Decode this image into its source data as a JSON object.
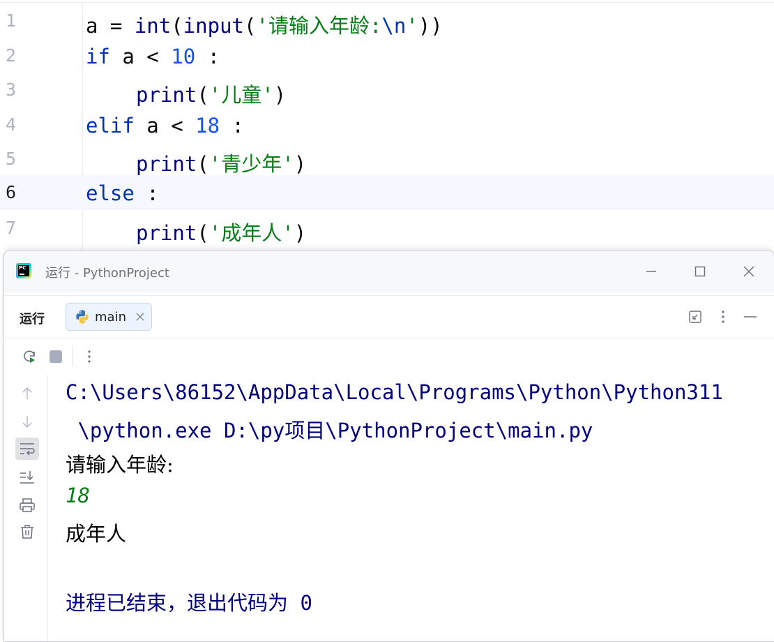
{
  "editor": {
    "lines": [
      {
        "num": "1",
        "segments": [
          {
            "text": "a = ",
            "cls": ""
          },
          {
            "text": "int",
            "cls": "tok-fn"
          },
          {
            "text": "(",
            "cls": ""
          },
          {
            "text": "input",
            "cls": "tok-fn"
          },
          {
            "text": "(",
            "cls": ""
          },
          {
            "text": "'请输入年龄:",
            "cls": "tok-str"
          },
          {
            "text": "\\n",
            "cls": "tok-kw"
          },
          {
            "text": "'",
            "cls": "tok-str"
          },
          {
            "text": "))",
            "cls": ""
          }
        ]
      },
      {
        "num": "2",
        "segments": [
          {
            "text": "if",
            "cls": "tok-kw"
          },
          {
            "text": " a < ",
            "cls": ""
          },
          {
            "text": "10",
            "cls": "tok-num"
          },
          {
            "text": " :",
            "cls": ""
          }
        ]
      },
      {
        "num": "3",
        "segments": [
          {
            "text": "print",
            "cls": "tok-fn"
          },
          {
            "text": "(",
            "cls": ""
          },
          {
            "text": "'儿童'",
            "cls": "tok-str"
          },
          {
            "text": ")",
            "cls": ""
          }
        ]
      },
      {
        "num": "4",
        "segments": [
          {
            "text": "elif",
            "cls": "tok-kw"
          },
          {
            "text": " a < ",
            "cls": ""
          },
          {
            "text": "18",
            "cls": "tok-num"
          },
          {
            "text": " :",
            "cls": ""
          }
        ]
      },
      {
        "num": "5",
        "segments": [
          {
            "text": "print",
            "cls": "tok-fn"
          },
          {
            "text": "(",
            "cls": ""
          },
          {
            "text": "'青少年'",
            "cls": "tok-str"
          },
          {
            "text": ")",
            "cls": ""
          }
        ]
      },
      {
        "num": "6",
        "segments": [
          {
            "text": "else",
            "cls": "tok-kw"
          },
          {
            "text": " :",
            "cls": ""
          }
        ]
      },
      {
        "num": "7",
        "segments": [
          {
            "text": "print",
            "cls": "tok-fn"
          },
          {
            "text": "(",
            "cls": ""
          },
          {
            "text": "'成年人'",
            "cls": "tok-str"
          },
          {
            "text": ")",
            "cls": ""
          }
        ]
      }
    ],
    "current_line": "6"
  },
  "run_window": {
    "title": "运行 - PythonProject",
    "run_label": "运行",
    "tab": {
      "label": "main",
      "icon": "python-icon"
    },
    "window_buttons": [
      "minimize-icon",
      "maximize-icon",
      "close-icon"
    ],
    "tab_bar_icons": [
      "restore-layout-icon",
      "more-vertical-icon",
      "hide-icon"
    ],
    "toolbar_icons": [
      "rerun-icon",
      "stop-icon",
      "more-vertical-icon"
    ],
    "side_icons": [
      "arrow-up-icon",
      "arrow-down-icon",
      "soft-wrap-icon",
      "scroll-to-end-icon",
      "print-icon",
      "trash-icon"
    ]
  },
  "console": {
    "command_line_1": "C:\\Users\\86152\\AppData\\Local\\Programs\\Python\\Python311",
    "command_line_2": " \\python.exe D:\\py项目\\PythonProject\\main.py",
    "prompt": "请输入年龄:",
    "user_input": "18",
    "output": "成年人",
    "exit_message": "进程已结束，退出代码为 0"
  },
  "colors": {
    "keyword": "#0033b3",
    "string": "#067d17",
    "number": "#1750eb",
    "function": "#000080",
    "console_text": "#000080",
    "current_line_bg": "#f5f8fe",
    "tab_bg": "#edf3ff"
  }
}
